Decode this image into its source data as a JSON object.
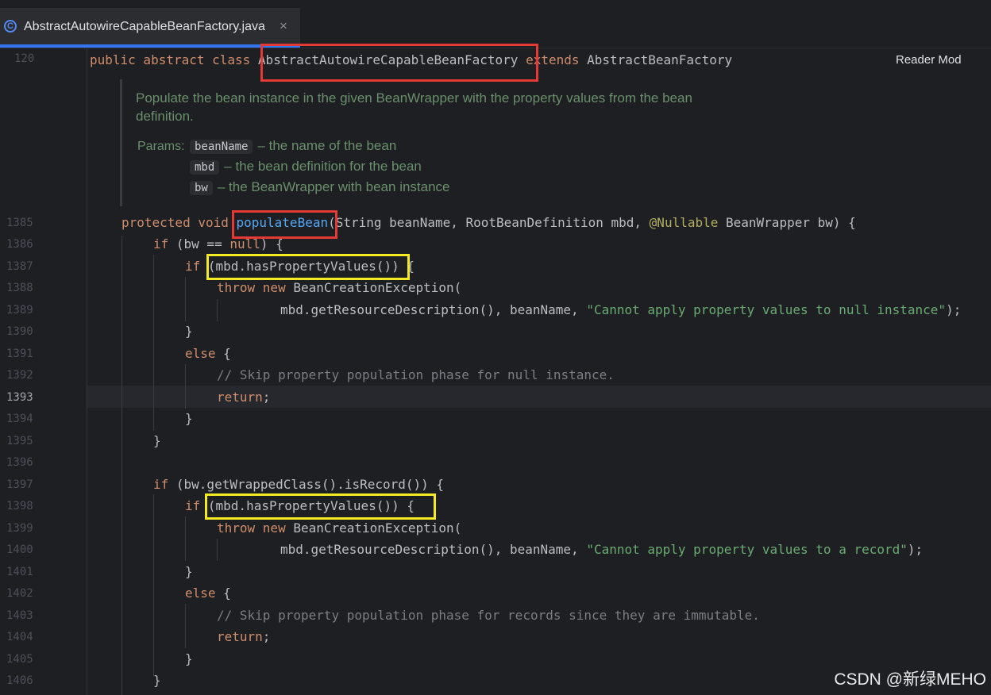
{
  "tab": {
    "icon": "class-c-icon",
    "title": "AbstractAutowireCapableBeanFactory.java",
    "close": "×"
  },
  "reader_mode": "Reader Mod",
  "header_line": {
    "number": "120",
    "kw1": "public abstract class ",
    "class_name": "AbstractAutowireCapableBeanFactory",
    "kw2": " extends ",
    "parent": "AbstractBeanFactory"
  },
  "doc": {
    "line1": "Populate the bean instance in the given BeanWrapper with the property values from the bean",
    "line2": "definition.",
    "params_label": "Params:",
    "params": [
      {
        "name": "beanName",
        "desc": "– the name of the bean"
      },
      {
        "name": "mbd",
        "desc": "– the bean definition for the bean"
      },
      {
        "name": "bw",
        "desc": "– the BeanWrapper with bean instance"
      }
    ]
  },
  "lines": [
    {
      "n": "1385"
    },
    {
      "n": "1386"
    },
    {
      "n": "1387"
    },
    {
      "n": "1388"
    },
    {
      "n": "1389"
    },
    {
      "n": "1390"
    },
    {
      "n": "1391"
    },
    {
      "n": "1392"
    },
    {
      "n": "1393"
    },
    {
      "n": "1394"
    },
    {
      "n": "1395"
    },
    {
      "n": "1396"
    },
    {
      "n": "1397"
    },
    {
      "n": "1398"
    },
    {
      "n": "1399"
    },
    {
      "n": "1400"
    },
    {
      "n": "1401"
    },
    {
      "n": "1402"
    },
    {
      "n": "1403"
    },
    {
      "n": "1404"
    },
    {
      "n": "1405"
    },
    {
      "n": "1406"
    }
  ],
  "code": {
    "l1385": {
      "kw": "protected void ",
      "fn": "populateBean",
      "a": "(String beanName, RootBeanDefinition mbd, ",
      "ann": "@Nullable",
      "b": " BeanWrapper bw) {"
    },
    "l1386": {
      "kw": "if",
      "a": " (bw == ",
      "kw2": "null",
      "b": ") {"
    },
    "l1387": {
      "kw": "if",
      "a": " (mbd.hasPropertyValues()) {"
    },
    "l1388": {
      "kw": "throw new",
      "a": " BeanCreationException("
    },
    "l1389": {
      "a": "mbd.getResourceDescription(), beanName, ",
      "str": "\"Cannot apply property values to null instance\"",
      "b": ");"
    },
    "l1390": {
      "a": "}"
    },
    "l1391": {
      "kw": "else",
      "a": " {"
    },
    "l1392": {
      "cmt": "// Skip property population phase for null instance."
    },
    "l1393": {
      "kw": "return",
      "a": ";"
    },
    "l1394": {
      "a": "}"
    },
    "l1395": {
      "a": "}"
    },
    "l1397": {
      "kw": "if",
      "a": " (bw.getWrappedClass().isRecord()) {"
    },
    "l1398": {
      "kw": "if",
      "a": " (mbd.hasPropertyValues()) {"
    },
    "l1399": {
      "kw": "throw new",
      "a": " BeanCreationException("
    },
    "l1400": {
      "a": "mbd.getResourceDescription(), beanName, ",
      "str": "\"Cannot apply property values to a record\"",
      "b": ");"
    },
    "l1401": {
      "a": "}"
    },
    "l1402": {
      "kw": "else",
      "a": " {"
    },
    "l1403": {
      "cmt": "// Skip property population phase for records since they are immutable."
    },
    "l1404": {
      "kw": "return",
      "a": ";"
    },
    "l1405": {
      "a": "}"
    },
    "l1406": {
      "a": "}"
    }
  },
  "watermark": "CSDN @新绿MEHO",
  "colors": {
    "background": "#1e1f22",
    "keyword": "#cf8e6d",
    "function": "#56a8f5",
    "string": "#6aab73",
    "comment": "#7a7e85",
    "annotation": "#b3ae60",
    "highlight_red": "#e53935",
    "highlight_yellow": "#f4ea23"
  }
}
